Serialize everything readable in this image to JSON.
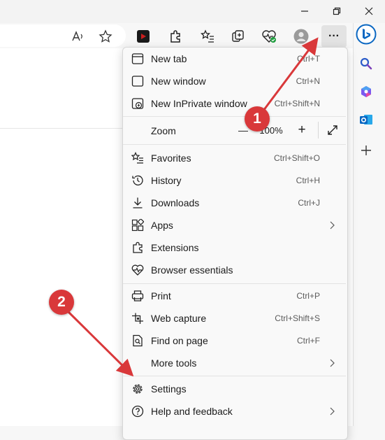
{
  "window": {
    "controls": [
      "minimize-icon",
      "restore-icon",
      "close-icon"
    ]
  },
  "toolbar": {
    "icons": [
      "read-aloud-icon",
      "favorite-star-icon",
      "youtube-extension-icon",
      "extensions-puzzle-icon",
      "favorites-list-icon",
      "collections-icon",
      "browser-essentials-icon",
      "profile-avatar-icon",
      "settings-and-more-icon"
    ],
    "more_label": "···"
  },
  "sidebar": {
    "icons": [
      "bing-copilot-icon",
      "search-icon",
      "microsoft-365-icon",
      "outlook-icon",
      "add-icon"
    ]
  },
  "menu": {
    "new_tab": {
      "label": "New tab",
      "shortcut": "Ctrl+T"
    },
    "new_window": {
      "label": "New window",
      "shortcut": "Ctrl+N"
    },
    "new_inprivate": {
      "label": "New InPrivate window",
      "shortcut": "Ctrl+Shift+N"
    },
    "zoom": {
      "label": "Zoom",
      "value": "100%",
      "minus": "—",
      "plus": "+"
    },
    "favorites": {
      "label": "Favorites",
      "shortcut": "Ctrl+Shift+O"
    },
    "history": {
      "label": "History",
      "shortcut": "Ctrl+H"
    },
    "downloads": {
      "label": "Downloads",
      "shortcut": "Ctrl+J"
    },
    "apps": {
      "label": "Apps"
    },
    "extensions": {
      "label": "Extensions"
    },
    "browser_essentials": {
      "label": "Browser essentials"
    },
    "print": {
      "label": "Print",
      "shortcut": "Ctrl+P"
    },
    "web_capture": {
      "label": "Web capture",
      "shortcut": "Ctrl+Shift+S"
    },
    "find_on_page": {
      "label": "Find on page",
      "shortcut": "Ctrl+F"
    },
    "more_tools": {
      "label": "More tools"
    },
    "settings": {
      "label": "Settings"
    },
    "help_feedback": {
      "label": "Help and feedback"
    }
  },
  "annotations": {
    "badge1": "1",
    "badge2": "2",
    "color": "#d9383a"
  },
  "colors": {
    "accent": "#0a67c2",
    "youtube": "#cc1f1f",
    "health_green": "#1e9e3e"
  }
}
